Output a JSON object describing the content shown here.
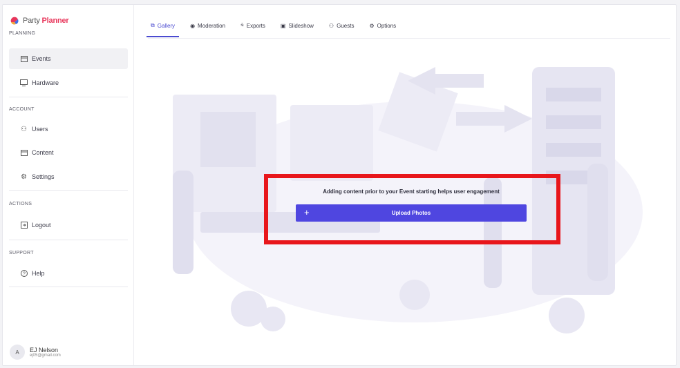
{
  "app": {
    "logo_prefix": "Party",
    "logo_brand": "Planner",
    "brand_color": "#e8355a",
    "accent_color": "#4f46e0"
  },
  "sidebar": {
    "sections": [
      {
        "label": "PLANNING"
      },
      {
        "label": "ACCOUNT"
      },
      {
        "label": "ACTIONS"
      },
      {
        "label": "SUPPORT"
      }
    ],
    "items": [
      {
        "label": "Events",
        "icon": "calendar-icon",
        "active": true
      },
      {
        "label": "Hardware",
        "icon": "monitor-icon"
      },
      {
        "label": "Users",
        "icon": "users-icon"
      },
      {
        "label": "Content",
        "icon": "content-icon"
      },
      {
        "label": "Settings",
        "icon": "gear-icon"
      },
      {
        "label": "Logout",
        "icon": "logout-icon"
      },
      {
        "label": "Help",
        "icon": "help-icon"
      }
    ],
    "user": {
      "initial": "A",
      "name": "EJ Nelson",
      "email": "ej05@gmail.com"
    }
  },
  "tabs": [
    {
      "label": "Gallery",
      "icon": "gallery-icon",
      "active": true
    },
    {
      "label": "Moderation",
      "icon": "moderation-icon"
    },
    {
      "label": "Exports",
      "icon": "exports-icon"
    },
    {
      "label": "Slideshow",
      "icon": "slideshow-icon"
    },
    {
      "label": "Guests",
      "icon": "guests-icon"
    },
    {
      "label": "Options",
      "icon": "options-icon"
    }
  ],
  "empty_state": {
    "hint": "Adding content prior to your Event starting helps user engagement",
    "button_label": "Upload Photos",
    "button_icon": "plus-icon"
  }
}
